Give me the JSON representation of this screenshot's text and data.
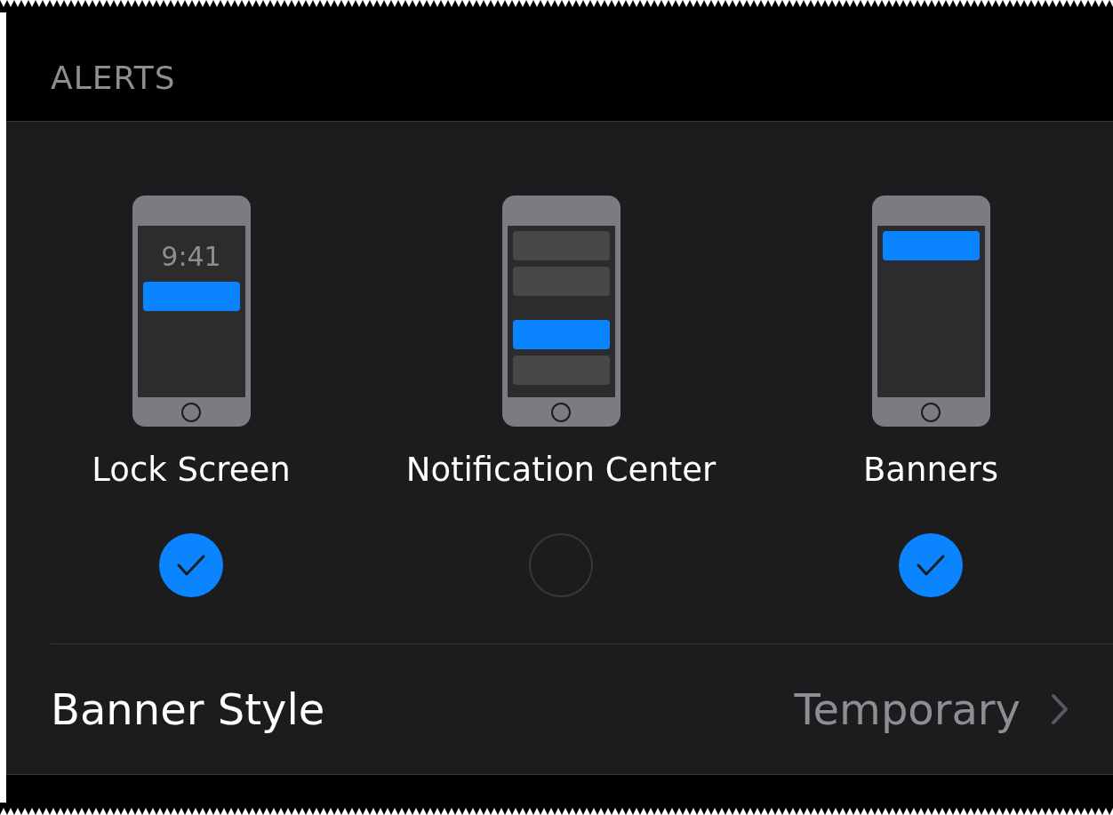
{
  "section_header": "ALERTS",
  "options": [
    {
      "kind": "lock",
      "label": "Lock Screen",
      "screen_time": "9:41",
      "checked": true
    },
    {
      "kind": "center",
      "label": "Notification Center",
      "checked": false
    },
    {
      "kind": "banners",
      "label": "Banners",
      "checked": true
    }
  ],
  "banner_style": {
    "label": "Banner Style",
    "value": "Temporary"
  }
}
